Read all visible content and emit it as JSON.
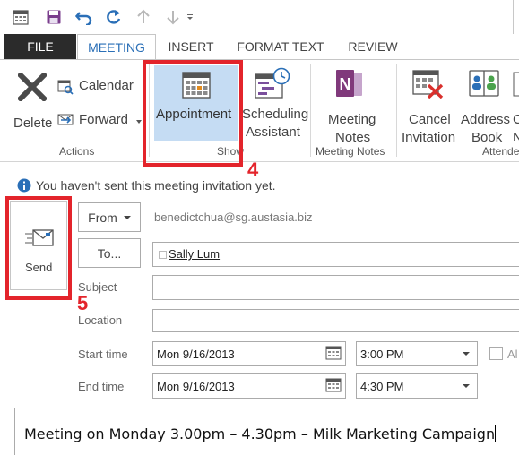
{
  "qat": {
    "icons": [
      "calendar-icon",
      "save-icon",
      "undo-icon",
      "redo-icon",
      "up-arrow-icon",
      "down-arrow-icon",
      "customize-icon"
    ]
  },
  "tabs": {
    "file": "FILE",
    "meeting": "MEETING",
    "insert": "INSERT",
    "format_text": "FORMAT TEXT",
    "review": "REVIEW"
  },
  "ribbon": {
    "actions": {
      "delete": "Delete",
      "calendar": "Calendar",
      "forward": "Forward",
      "group_label": "Actions"
    },
    "show": {
      "appointment": "Appointment",
      "scheduling_line1": "Scheduling",
      "scheduling_line2": "Assistant",
      "group_label": "Show"
    },
    "meeting_notes": {
      "label_line1": "Meeting",
      "label_line2": "Notes",
      "group_label": "Meeting Notes"
    },
    "attendees": {
      "cancel_line1": "Cancel",
      "cancel_line2": "Invitation",
      "address_line1": "Address",
      "address_line2": "Book",
      "check_line1": "C",
      "check_line2": "N",
      "group_label": "Attende"
    }
  },
  "annotations": {
    "step4": "4",
    "step5": "5"
  },
  "info_bar": {
    "message": "You haven't sent this meeting invitation yet."
  },
  "form": {
    "send": "Send",
    "from_button": "From",
    "from_address": "benedictchua@sg.austasia.biz",
    "to_button": "To...",
    "to_value": "Sally Lum",
    "subject_label": "Subject",
    "subject_value": "",
    "location_label": "Location",
    "location_value": "",
    "start_label": "Start time",
    "start_date": "Mon 9/16/2013",
    "start_time": "3:00 PM",
    "end_label": "End time",
    "end_date": "Mon 9/16/2013",
    "end_time": "4:30 PM",
    "all_day_label": "Al"
  },
  "body": {
    "text": "Meeting on Monday 3.00pm – 4.30pm – Milk Marketing Campaign"
  },
  "colors": {
    "accent": "#2a6fb7",
    "file_tab": "#2b2b2b",
    "highlight": "#e3242b",
    "selected_button": "#c5dcf3",
    "onenote_purple": "#80397b"
  }
}
